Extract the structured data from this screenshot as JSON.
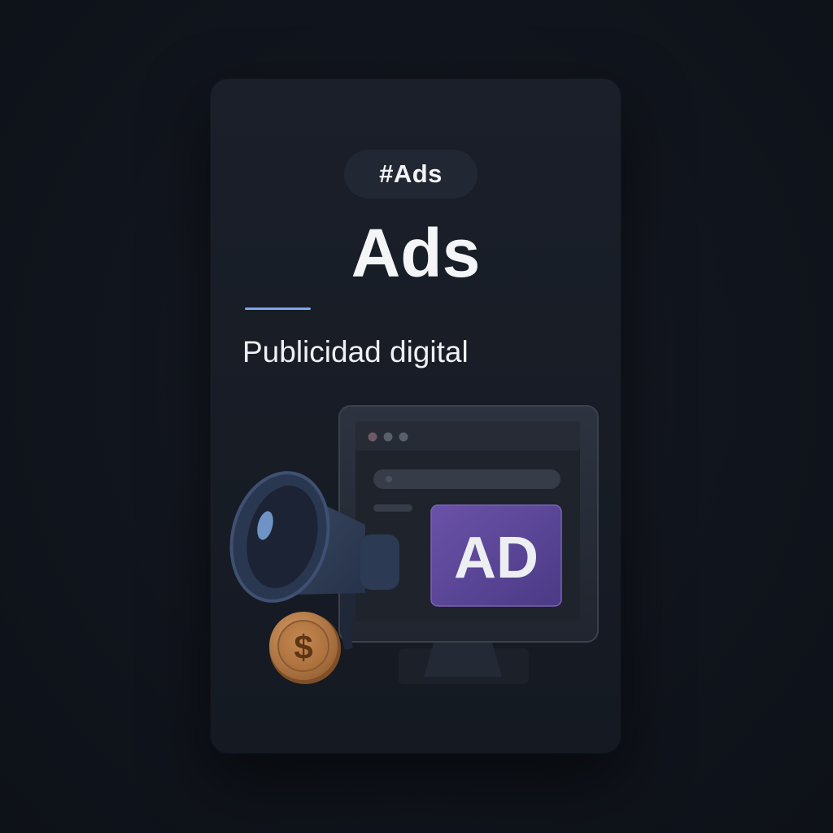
{
  "card": {
    "tag": "#Ads",
    "title": "Ads",
    "subtitle": "Publicidad digital"
  },
  "illustration": {
    "ad_label": "AD",
    "coin_symbol": "$",
    "icons": [
      "megaphone-icon",
      "monitor-icon",
      "dollar-coin-icon"
    ]
  },
  "colors": {
    "background": "#10141c",
    "card": "#1a1f29",
    "accent_line": "#7aa7e8",
    "ad_badge": "#5b4596",
    "coin": "#b77a45"
  }
}
